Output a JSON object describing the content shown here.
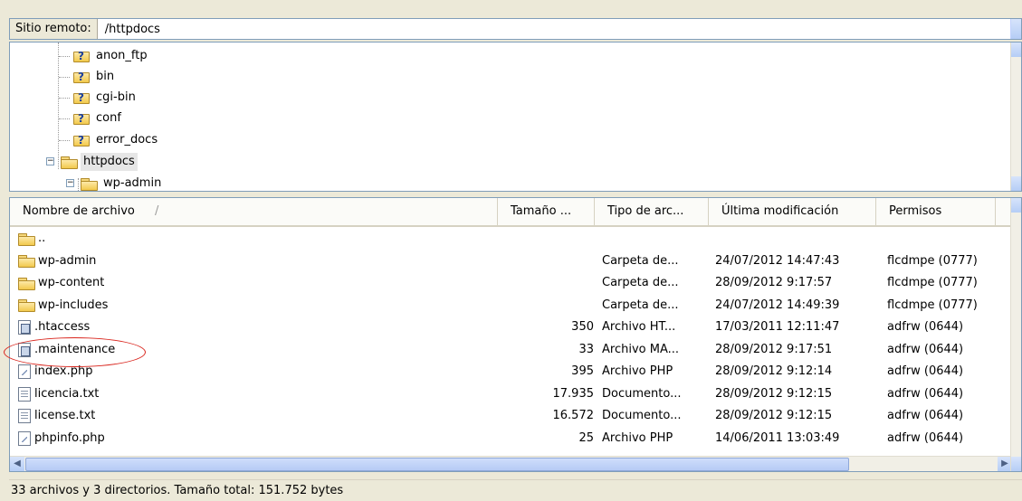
{
  "remote": {
    "label": "Sitio remoto:",
    "path": "/httpdocs"
  },
  "tree": {
    "items": [
      {
        "label": "anon_ftp",
        "icon": "unknown-folder-icon"
      },
      {
        "label": "bin",
        "icon": "unknown-folder-icon"
      },
      {
        "label": "cgi-bin",
        "icon": "unknown-folder-icon"
      },
      {
        "label": "conf",
        "icon": "unknown-folder-icon"
      },
      {
        "label": "error_docs",
        "icon": "unknown-folder-icon"
      },
      {
        "label": "httpdocs",
        "icon": "folder-icon",
        "expanded": true,
        "selected": true
      },
      {
        "label": "wp-admin",
        "icon": "folder-icon",
        "expanded": true
      }
    ]
  },
  "columns": {
    "name": "Nombre de archivo",
    "sort_indicator": "/",
    "size": "Tamaño ...",
    "type": "Tipo de arc...",
    "modified": "Última modificación",
    "perms": "Permisos"
  },
  "files": [
    {
      "name": "..",
      "icon": "folder-icon",
      "size": "",
      "type": "",
      "modified": "",
      "perms": ""
    },
    {
      "name": "wp-admin",
      "icon": "folder-icon",
      "size": "",
      "type": "Carpeta de...",
      "modified": "24/07/2012 14:47:43",
      "perms": "flcdmpe (0777)"
    },
    {
      "name": "wp-content",
      "icon": "folder-icon",
      "size": "",
      "type": "Carpeta de...",
      "modified": "28/09/2012 9:17:57",
      "perms": "flcdmpe (0777)"
    },
    {
      "name": "wp-includes",
      "icon": "folder-icon",
      "size": "",
      "type": "Carpeta de...",
      "modified": "24/07/2012 14:49:39",
      "perms": "flcdmpe (0777)"
    },
    {
      "name": ".htaccess",
      "icon": "config-file-icon",
      "size": "350",
      "type": "Archivo HT...",
      "modified": "17/03/2011 12:11:47",
      "perms": "adfrw (0644)"
    },
    {
      "name": ".maintenance",
      "icon": "config-file-icon",
      "size": "33",
      "type": "Archivo MA...",
      "modified": "28/09/2012 9:17:51",
      "perms": "adfrw (0644)"
    },
    {
      "name": "index.php",
      "icon": "php-file-icon",
      "size": "395",
      "type": "Archivo PHP",
      "modified": "28/09/2012 9:12:14",
      "perms": "adfrw (0644)"
    },
    {
      "name": "licencia.txt",
      "icon": "text-file-icon",
      "size": "17.935",
      "type": "Documento...",
      "modified": "28/09/2012 9:12:15",
      "perms": "adfrw (0644)"
    },
    {
      "name": "license.txt",
      "icon": "text-file-icon",
      "size": "16.572",
      "type": "Documento...",
      "modified": "28/09/2012 9:12:15",
      "perms": "adfrw (0644)"
    },
    {
      "name": "phpinfo.php",
      "icon": "php-file-icon",
      "size": "25",
      "type": "Archivo PHP",
      "modified": "14/06/2011 13:03:49",
      "perms": "adfrw (0644)"
    }
  ],
  "status": "33 archivos y 3 directorios. Tamaño total: 151.752 bytes",
  "colors": {
    "annotation": "#d9241c",
    "selection": "#e6e6e6"
  }
}
